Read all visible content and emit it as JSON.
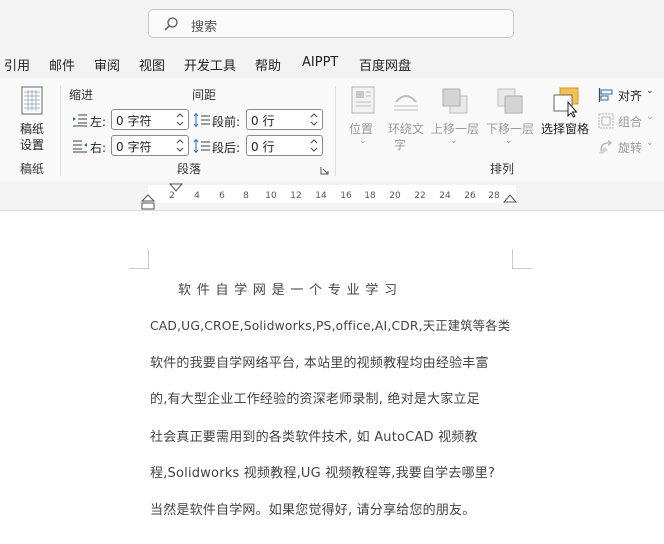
{
  "search": {
    "placeholder": "搜索"
  },
  "menu": [
    "引用",
    "邮件",
    "审阅",
    "视图",
    "开发工具",
    "帮助",
    "AIPPT",
    "百度网盘"
  ],
  "ribbon": {
    "draft": {
      "button_line1": "稿纸",
      "button_line2": "设置",
      "group_label": "稿纸"
    },
    "paragraph": {
      "indent_header": "缩进",
      "spacing_header": "间距",
      "left_label": "左:",
      "left_value": "0 字符",
      "right_label": "右:",
      "right_value": "0 字符",
      "before_label": "段前:",
      "before_value": "0 行",
      "after_label": "段后:",
      "after_value": "0 行",
      "group_label": "段落"
    },
    "arrange": {
      "position": "位置",
      "wrap_line1": "环绕文",
      "wrap_line2": "字",
      "bring_forward": "上移一层",
      "send_backward": "下移一层",
      "selection_pane": "选择窗格",
      "align": "对齐",
      "group": "组合",
      "rotate": "旋转",
      "group_label": "排列"
    }
  },
  "ruler": {
    "ticks": [
      "2",
      "4",
      "6",
      "8",
      "10",
      "12",
      "14",
      "16",
      "18",
      "20",
      "22",
      "24",
      "26",
      "28"
    ]
  },
  "document": {
    "lines": [
      "软 件 自 学 网 是 一 个 专 业 学 习",
      "CAD,UG,CROE,Solidworks,PS,office,AI,CDR,天正建筑等各类",
      "软件的我要自学网络平台, 本站里的视频教程均由经验丰富",
      "的,有大型企业工作经验的资深老师录制, 绝对是大家立足",
      "社会真正要需用到的各类软件技术, 如 AutoCAD 视频教",
      "程,Solidworks 视频教程,UG 视频教程等,我要自学去哪里?",
      "当然是软件自学网。如果您觉得好, 请分享给您的朋友。"
    ]
  },
  "colors": {
    "selection_pane_accent": "#f6c04e",
    "ribbon_bg": "#f9f9f9",
    "chrome_bg": "#f3f3f3"
  }
}
